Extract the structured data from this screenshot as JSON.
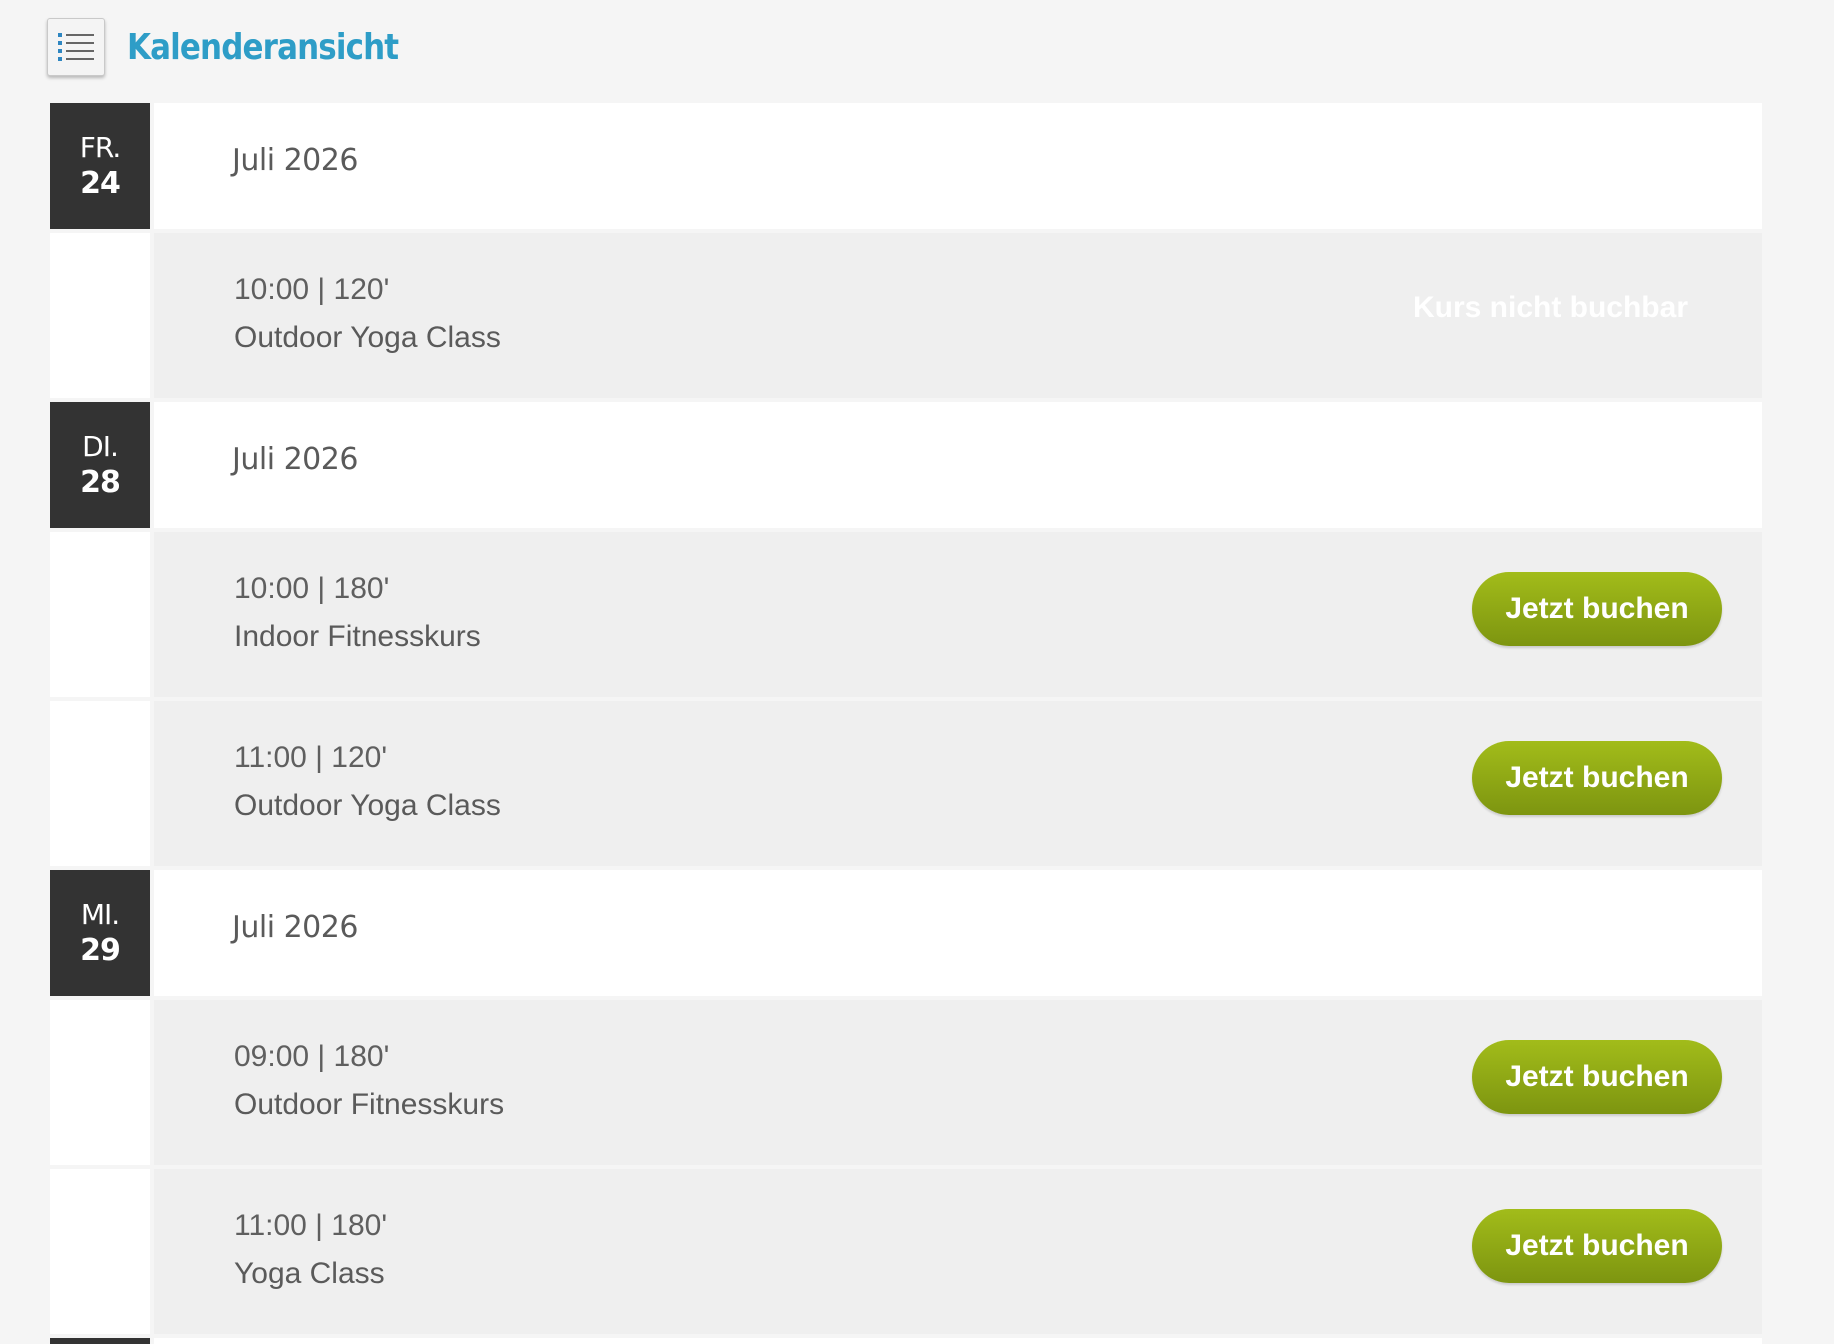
{
  "header": {
    "title": "Kalenderansicht",
    "toggle_icon": "list-icon",
    "accent_color": "#2e9dc7"
  },
  "colors": {
    "date_badge": "#333333",
    "button_green": "#8aa414"
  },
  "days": [
    {
      "weekday": "FR.",
      "day": "24",
      "month": "Juli 2026",
      "events": [
        {
          "time": "10:00 | 120'",
          "name": "Outdoor Yoga Class",
          "status": "Kurs nicht buchbar",
          "bookable": false
        }
      ]
    },
    {
      "weekday": "DI.",
      "day": "28",
      "month": "Juli 2026",
      "events": [
        {
          "time": "10:00 | 180'",
          "name": "Indoor Fitnesskurs",
          "action": "Jetzt buchen",
          "bookable": true
        },
        {
          "time": "11:00 | 120'",
          "name": "Outdoor Yoga Class",
          "action": "Jetzt buchen",
          "bookable": true
        }
      ]
    },
    {
      "weekday": "MI.",
      "day": "29",
      "month": "Juli 2026",
      "events": [
        {
          "time": "09:00 | 180'",
          "name": "Outdoor Fitnesskurs",
          "action": "Jetzt buchen",
          "bookable": true
        },
        {
          "time": "11:00 | 180'",
          "name": "Yoga Class",
          "action": "Jetzt buchen",
          "bookable": true
        }
      ]
    }
  ]
}
